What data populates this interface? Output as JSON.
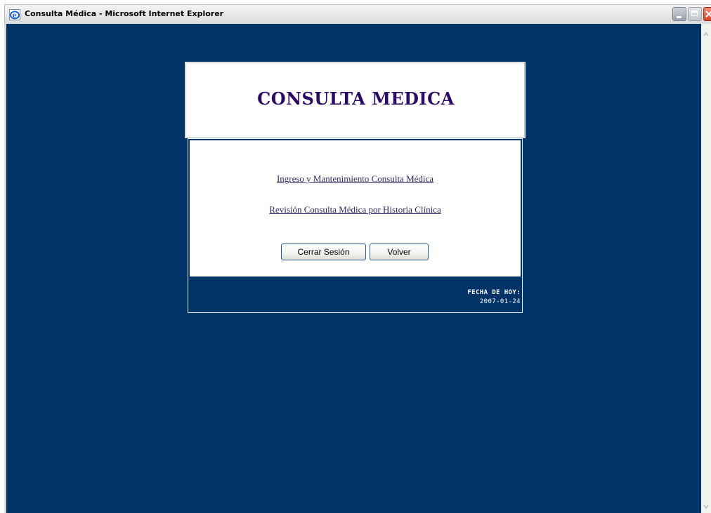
{
  "window": {
    "title": "Consulta Médica - Microsoft Internet Explorer",
    "icon": "ie-icon",
    "buttons": [
      "minimize-icon",
      "maximize-icon",
      "close-icon"
    ]
  },
  "page": {
    "background_color": "#003366",
    "header_title": "CONSULTA MEDICA",
    "links": [
      "Ingreso y Mantenimiento Consulta Médica",
      "Revisión Consulta Médica por Historia Clínica"
    ],
    "buttons": {
      "logout": "Cerrar Sesión",
      "back": "Volver"
    },
    "footer": {
      "date_label": "FECHA DE HOY:",
      "date_value": "2007-01-24"
    }
  }
}
